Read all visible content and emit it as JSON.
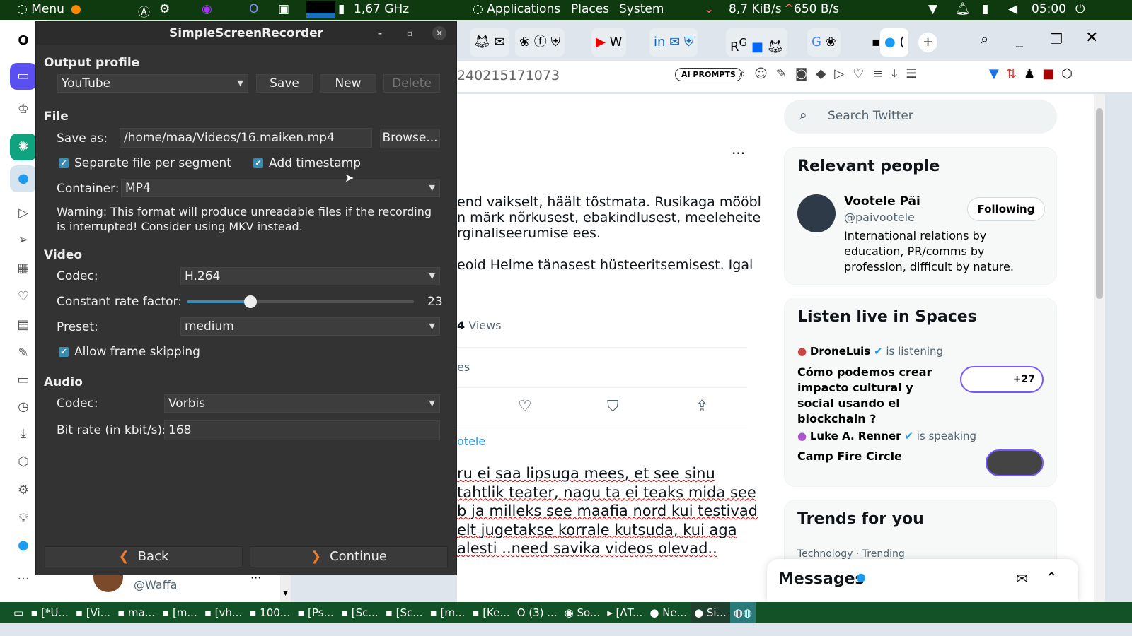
{
  "top_panel": {
    "menu": "Menu",
    "cpu": "1,67 GHz",
    "applications": "Applications",
    "places": "Places",
    "system": "System",
    "net_down": "8,7 KiB/s",
    "net_up": "650 B/s",
    "clock": "05:00"
  },
  "browser": {
    "url_fragment": "240215171073",
    "ai_prompts": "AI PROMPTS",
    "tab_title": "("
  },
  "tweet": {
    "text_lines": [
      "end vaikselt, häält tõstmata. Rusikaga mööbli",
      "n märk nõrkusest, ebakindlusest, meeleheitest",
      "rginaliseerumise ees."
    ],
    "text2": "eoid Helme tänasest hüsteeritsemisest. Igal",
    "views_prefix": "4",
    "views": "Views",
    "reposts_fragment": "es",
    "reply_user": "otele",
    "reply_lines": [
      "ru ei saa lipsuga mees, et see sinu",
      "tahtlik teater, nagu ta ei teaks mida see",
      "b ja milleks see maafia nord kui testivad",
      "elt jugetakse korrale kutsuda, kui aga",
      "alesti ..need savika videos olevad.."
    ],
    "bottom_handle": "@Waffa"
  },
  "right": {
    "search_placeholder": "Search Twitter",
    "relevant_title": "Relevant people",
    "person_name": "Vootele Päi",
    "person_handle": "@paivootele",
    "following": "Following",
    "person_bio": "International relations by education, PR/comms by profession, difficult by nature.",
    "spaces_title": "Listen live in Spaces",
    "space1_host": "DroneLuis",
    "space1_status": "is listening",
    "space1_title": "Cómo podemos crear impacto cultural y social usando el blockchain ?",
    "space1_count": "+27",
    "space2_host": "Luke A. Renner",
    "space2_status": "is speaking",
    "space2_title": "Camp Fire Circle",
    "trends_title": "Trends for you",
    "trend_meta": "Technology · Trending",
    "messages": "Messages"
  },
  "dialog": {
    "title": "SimpleScreenRecorder",
    "output_profile": "Output profile",
    "profile_value": "YouTube",
    "save": "Save",
    "new": "New",
    "delete": "Delete",
    "file": "File",
    "save_as_label": "Save as:",
    "save_as_value": "/home/maa/Videos/16.maiken.mp4",
    "browse": "Browse...",
    "separate_file": "Separate file per segment",
    "add_timestamp": "Add timestamp",
    "container_label": "Container:",
    "container_value": "MP4",
    "warning": "Warning: This format will produce unreadable files if the recording is interrupted! Consider using MKV instead.",
    "video": "Video",
    "codec_label": "Codec:",
    "video_codec": "H.264",
    "crf_label": "Constant rate factor:",
    "crf_value": "23",
    "crf_fraction": 0.28,
    "preset_label": "Preset:",
    "preset_value": "medium",
    "allow_frame_skipping": "Allow frame skipping",
    "audio": "Audio",
    "audio_codec_label": "Codec:",
    "audio_codec": "Vorbis",
    "bitrate_label": "Bit rate (in kbit/s):",
    "bitrate_value": "168",
    "back": "Back",
    "continue": "Continue"
  },
  "taskbar": {
    "items": [
      "[*U...",
      "[Vi...",
      "ma...",
      "[m...",
      "[vh...",
      "100...",
      "[Ps...",
      "[Sc...",
      "[Sc...",
      "[m...",
      "[Ke...",
      "(3) ...",
      "So...",
      "[ΛT...",
      "Ne...",
      "Si..."
    ]
  }
}
